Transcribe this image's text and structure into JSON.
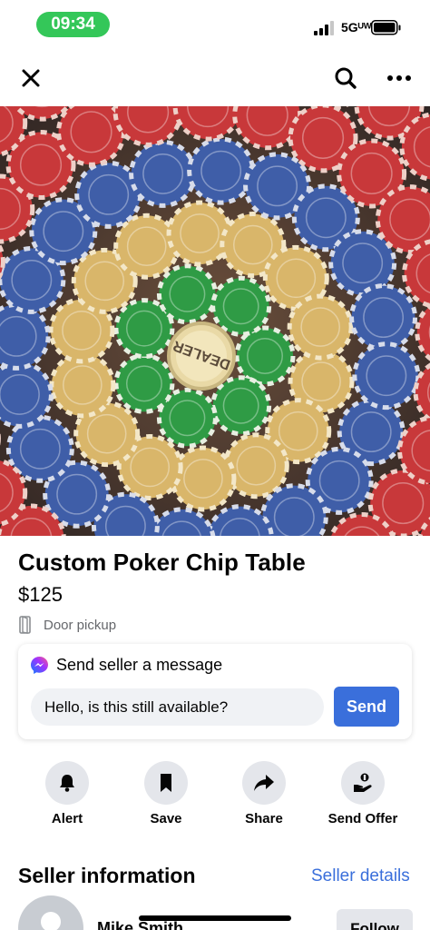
{
  "status_bar": {
    "time": "09:34",
    "network": "5Gᵁᵂ",
    "time_pill_color": "#34c759"
  },
  "top_nav": {
    "close_icon": "close-icon",
    "search_icon": "search-icon",
    "more_icon": "more-icon"
  },
  "hero": {
    "image_label": "DEALER"
  },
  "listing": {
    "title": "Custom Poker Chip Table",
    "price": "$125",
    "pickup": "Door pickup"
  },
  "message": {
    "heading": "Send seller a message",
    "input_value": "Hello, is this still available?",
    "send_label": "Send",
    "accent": "#3a6fdb"
  },
  "actions": [
    {
      "label": "Alert",
      "icon": "bell-icon"
    },
    {
      "label": "Save",
      "icon": "bookmark-icon"
    },
    {
      "label": "Share",
      "icon": "share-icon"
    },
    {
      "label": "Send Offer",
      "icon": "offer-icon"
    }
  ],
  "seller": {
    "heading": "Seller information",
    "details_link": "Seller details",
    "name": "Mike Smith",
    "follow_label": "Follow"
  }
}
